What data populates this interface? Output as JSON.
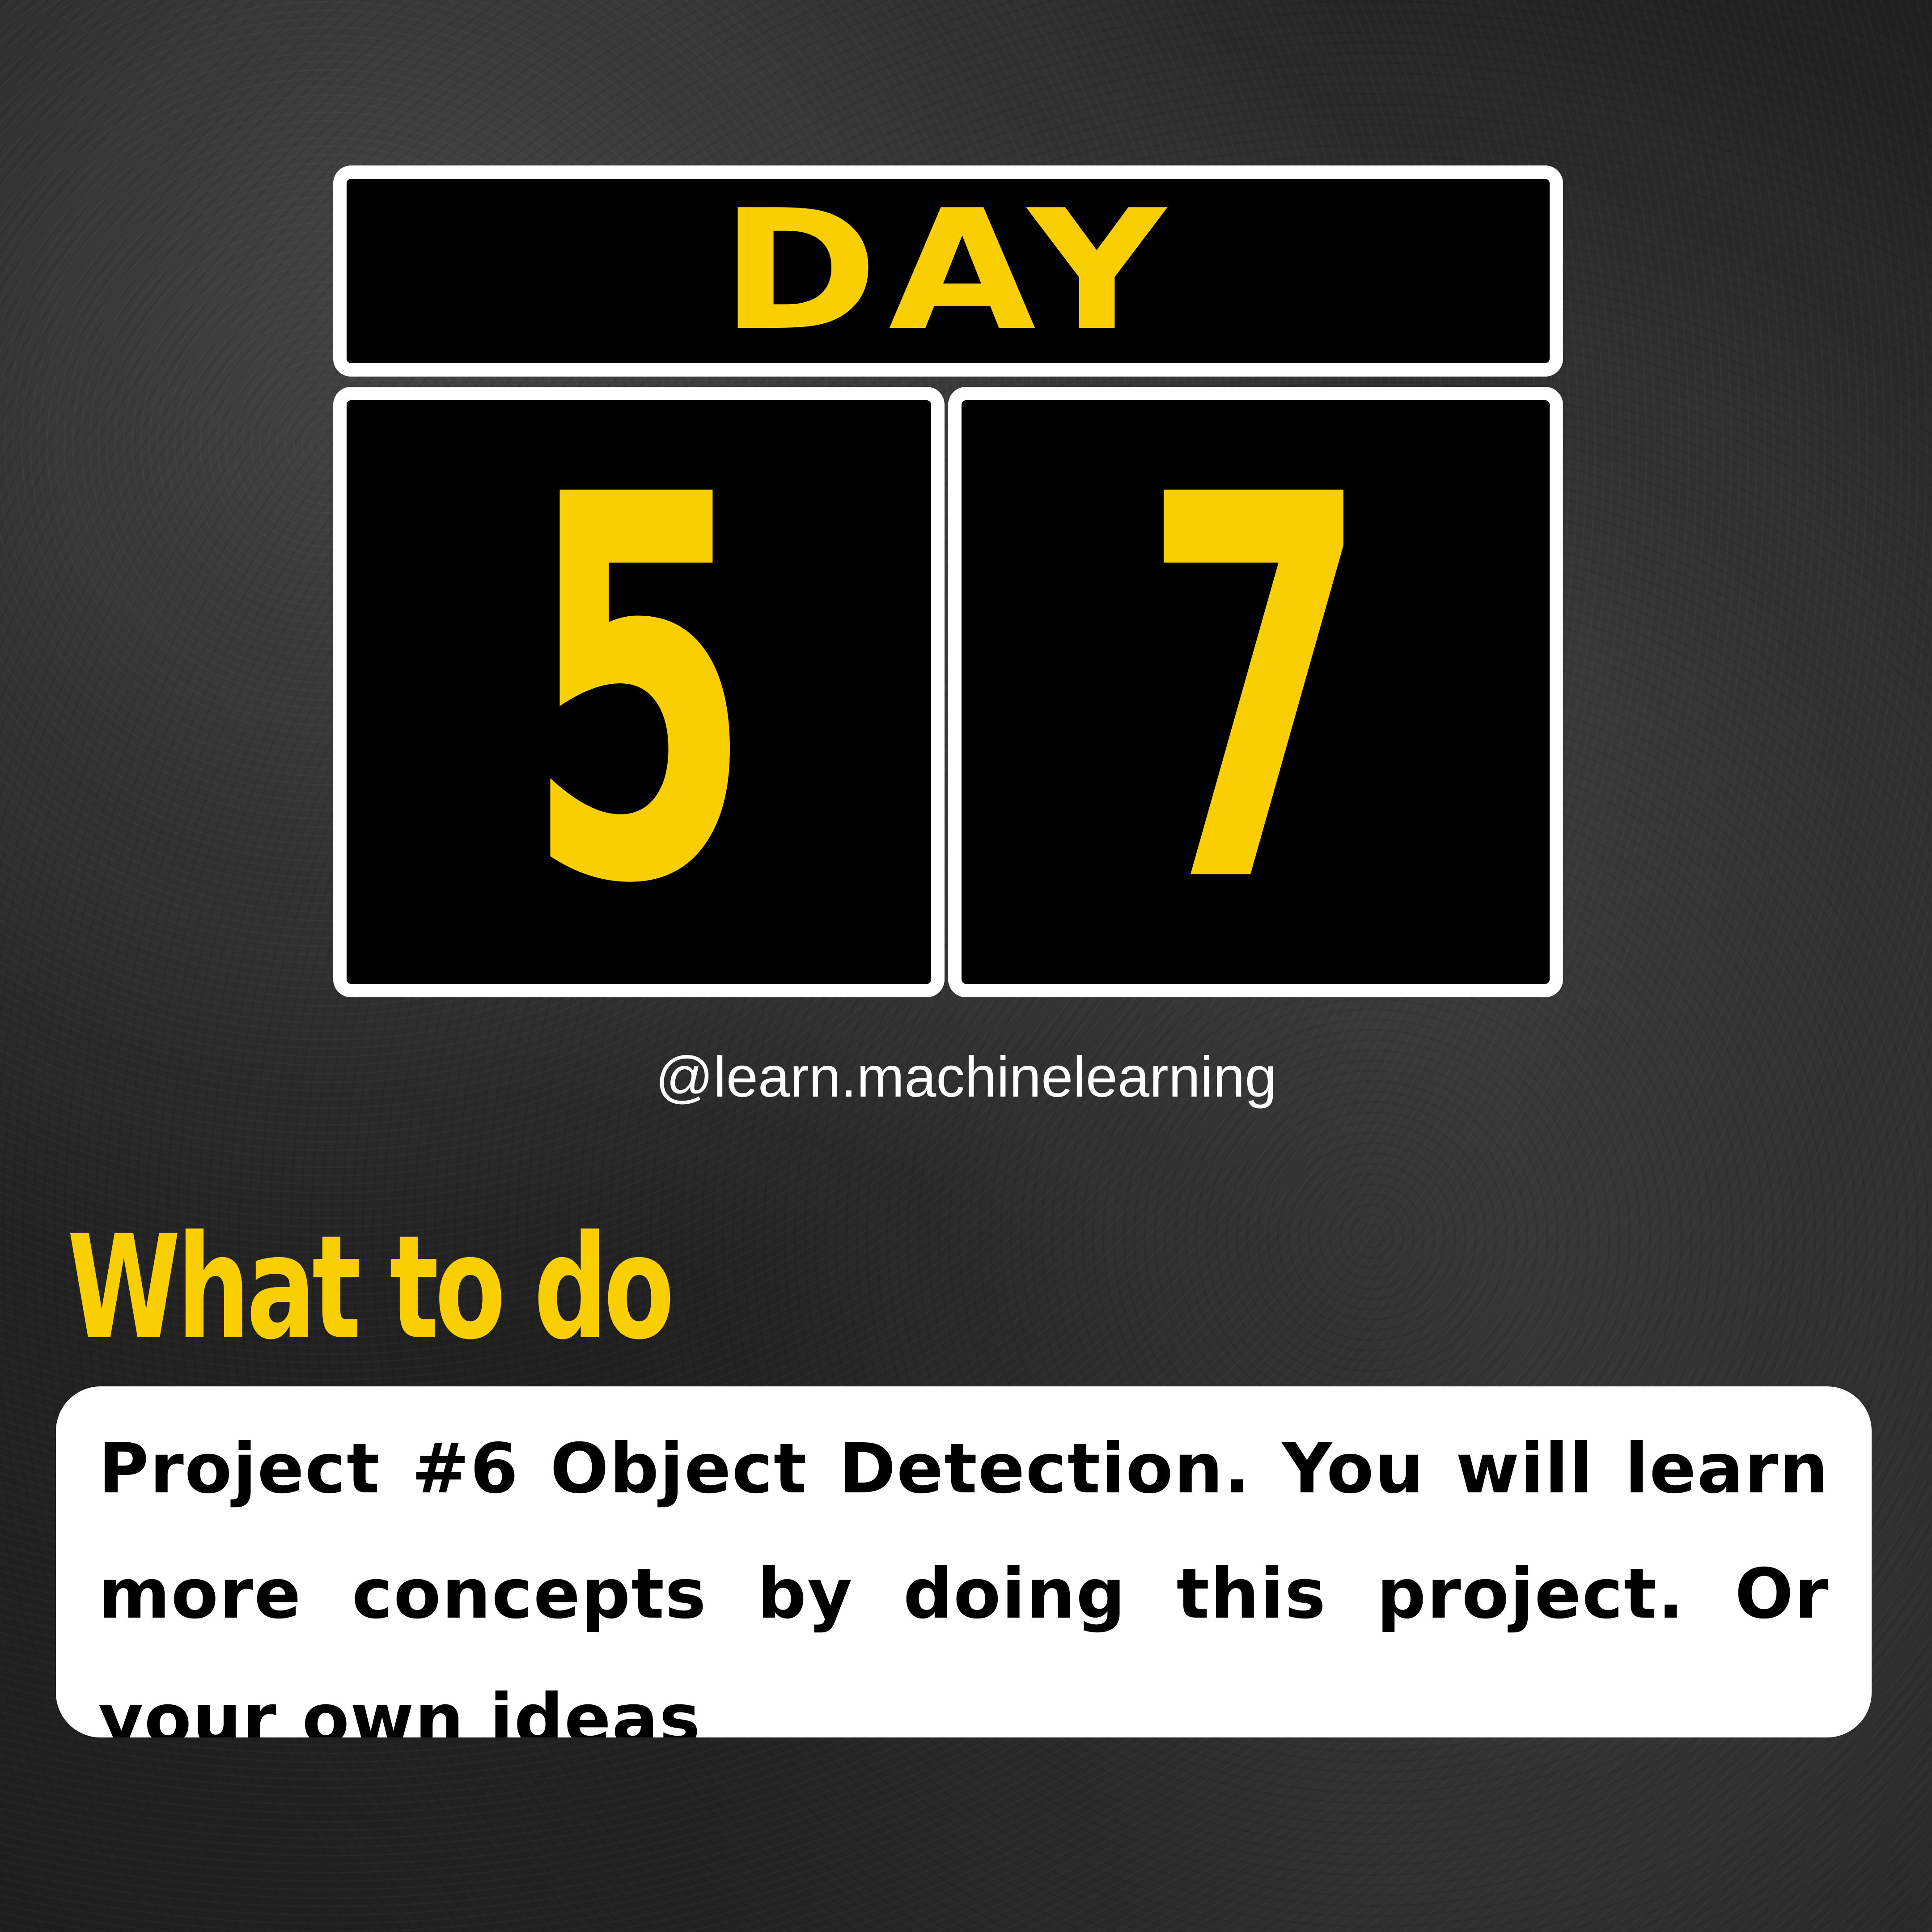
{
  "header": {
    "day_label": "DAY",
    "digits": [
      "5",
      "7"
    ]
  },
  "handle": "@learn.machinelearning",
  "section": {
    "heading": "What to do",
    "body": "Project #6 Object Detection. You will learn more concepts by doing this project. Or your own ideas"
  },
  "colors": {
    "accent": "#f9cf02",
    "tile_bg": "#000000",
    "tile_border": "#ffffff",
    "card_bg": "#ffffff",
    "background": "#2b2b2b"
  }
}
